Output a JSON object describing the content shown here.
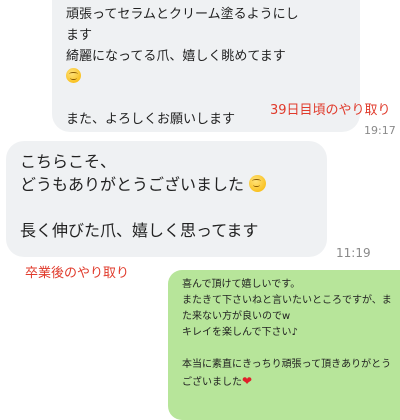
{
  "messages": [
    {
      "lines": [
        "頑張ってセラムとクリーム塗るようにし",
        "ます",
        "綺麗になってる爪、嬉しく眺めてます"
      ],
      "emoji": "relieved-smile-emoji",
      "closing": "また、よろしくお願いします",
      "time": "19:17"
    },
    {
      "lines": [
        "こちらこそ、",
        "どうもありがとうございました"
      ],
      "emoji": "relieved-smile-emoji",
      "line3": "長く伸びた爪、嬉しく思ってます",
      "time": "11:19"
    },
    {
      "lines": [
        "喜んで頂けて嬉しいです。",
        "またきて下さいねと言いたいところですが、ま",
        "た来ない方が良いのでw",
        "キレイを楽しんで下さい♪",
        "本当に素直にきっちり頑張って頂きありがとう",
        "ございました"
      ],
      "emoji": "red-heart-emoji"
    }
  ],
  "annotations": {
    "day39": "39日目頃のやり取り",
    "after_graduation": "卒業後のやり取り"
  },
  "colors": {
    "gray_bubble": "#eff1f3",
    "green_bubble": "#b7e59a",
    "annotation_red": "#e03a2b"
  }
}
